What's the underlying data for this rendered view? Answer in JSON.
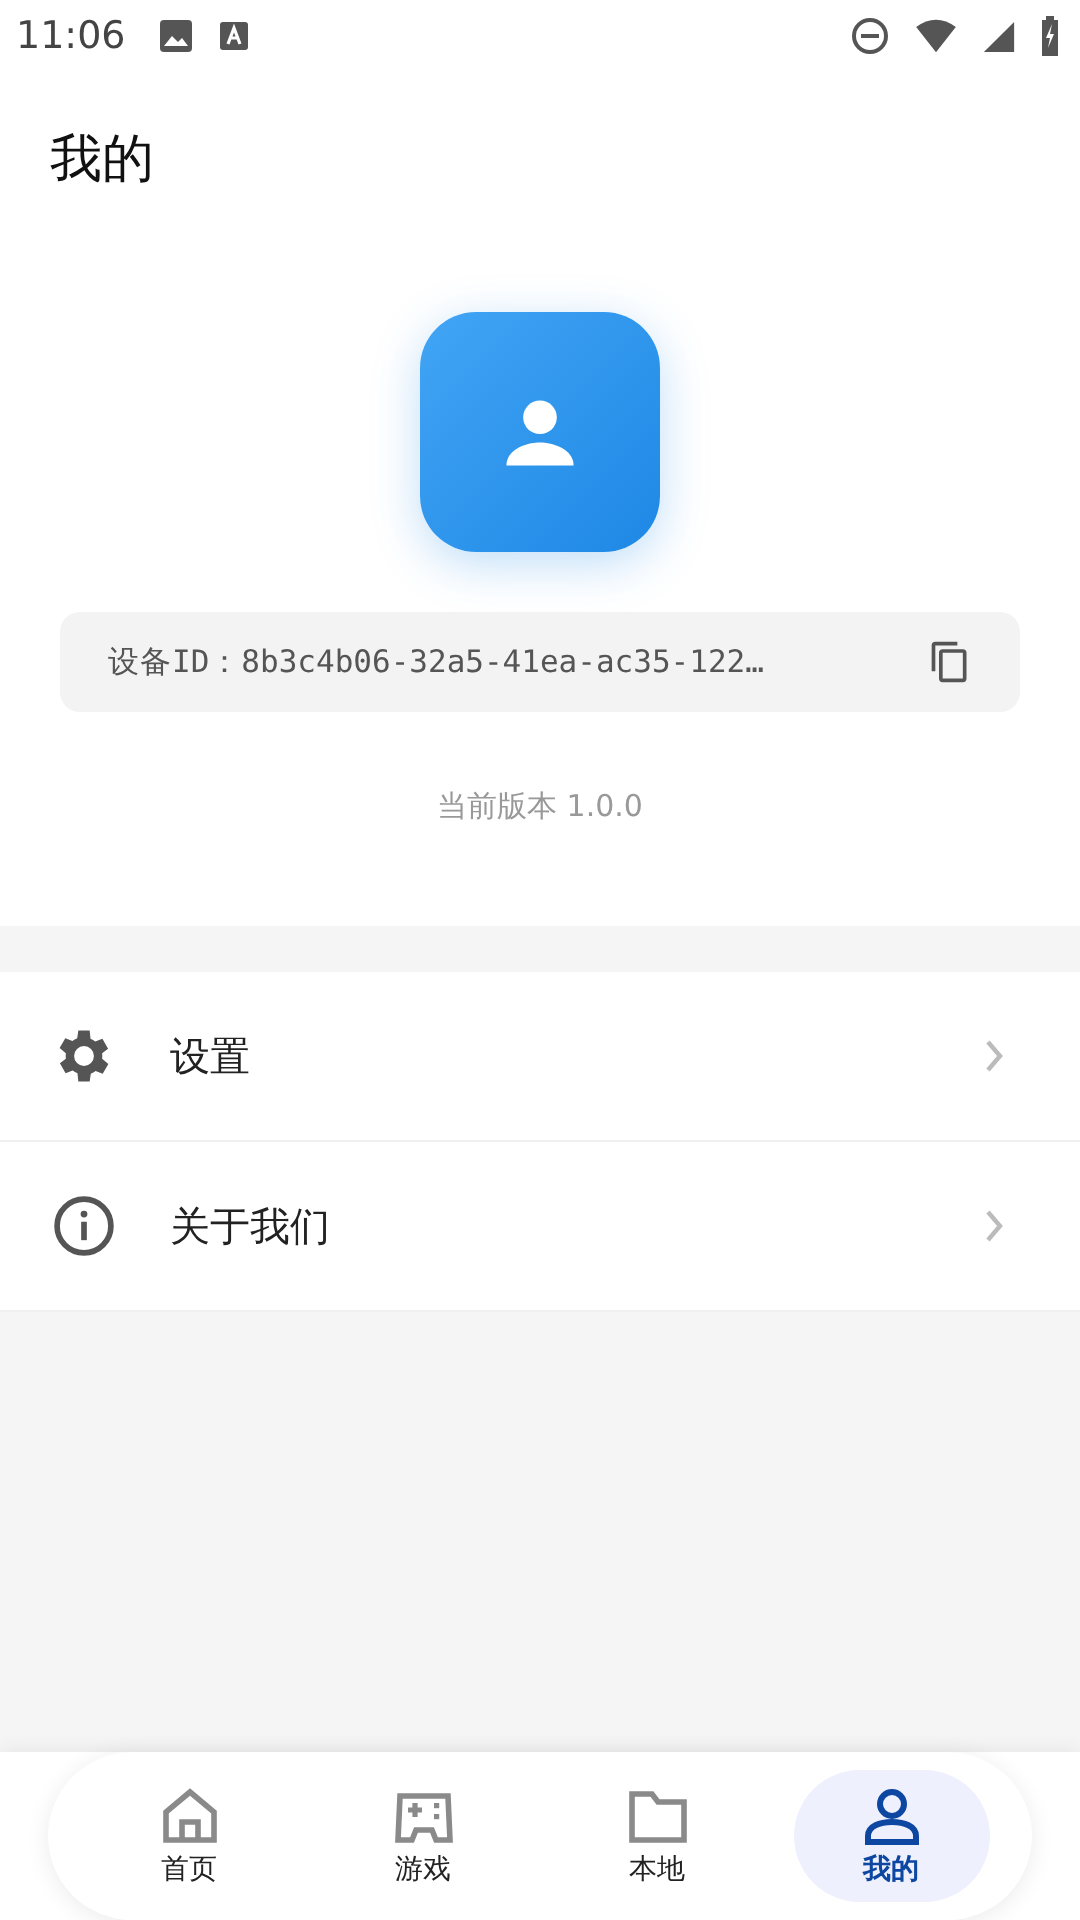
{
  "status_bar": {
    "time": "11:06"
  },
  "header": {
    "title": "我的"
  },
  "profile": {
    "device_id": "设备ID：8b3c4b06-32a5-41ea-ac35-122…",
    "version": "当前版本 1.0.0"
  },
  "menu": [
    {
      "kind": "settings",
      "label": "设置"
    },
    {
      "kind": "about",
      "label": "关于我们"
    }
  ],
  "bottom_nav": [
    {
      "kind": "home",
      "label": "首页",
      "selected": false
    },
    {
      "kind": "games",
      "label": "游戏",
      "selected": false
    },
    {
      "kind": "local",
      "label": "本地",
      "selected": false
    },
    {
      "kind": "mine",
      "label": "我的",
      "selected": true
    }
  ]
}
